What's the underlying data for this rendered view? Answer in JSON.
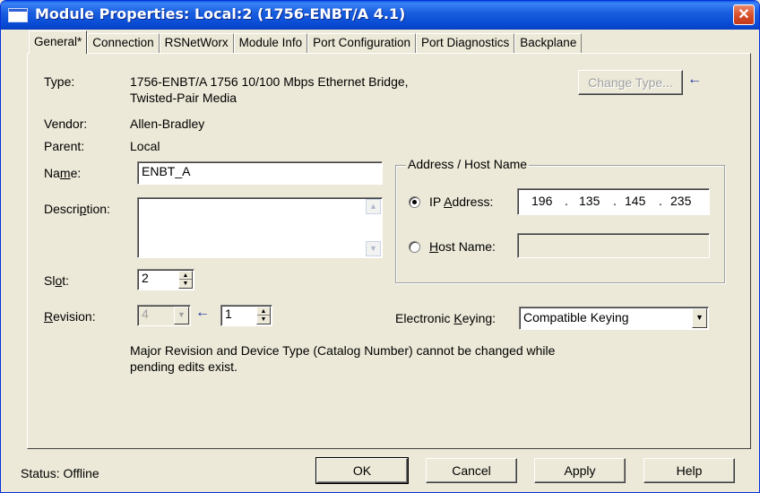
{
  "window": {
    "title": "Module Properties: Local:2 (1756-ENBT/A 4.1)"
  },
  "tabs": [
    {
      "label": "General*",
      "active": true
    },
    {
      "label": "Connection"
    },
    {
      "label": "RSNetWorx"
    },
    {
      "label": "Module Info"
    },
    {
      "label": "Port Configuration"
    },
    {
      "label": "Port Diagnostics"
    },
    {
      "label": "Backplane"
    }
  ],
  "general": {
    "type_label": "Type:",
    "type_value_line1": "1756-ENBT/A 1756 10/100 Mbps Ethernet Bridge,",
    "type_value_line2": "Twisted-Pair Media",
    "change_type_button": "Change Type...",
    "vendor_label": "Vendor:",
    "vendor_value": "Allen-Bradley",
    "parent_label": "Parent:",
    "parent_value": "Local",
    "name_label": "Name:",
    "name_value": "ENBT_A",
    "description_label": "Description:",
    "description_value": "",
    "slot_label": "Slot:",
    "slot_value": "2",
    "revision_label": "Revision:",
    "revision_major": "4",
    "revision_minor": "1",
    "note_line1": "Major Revision and Device Type (Catalog Number) cannot be changed while",
    "note_line2": "pending edits exist."
  },
  "address": {
    "group_title": "Address / Host Name",
    "ip_radio_label": "IP Address:",
    "ip_octets": [
      "196",
      "135",
      "145",
      "235"
    ],
    "host_radio_label": "Host Name:",
    "host_value": "",
    "selected": "ip"
  },
  "keying": {
    "label": "Electronic Keying:",
    "value": "Compatible Keying"
  },
  "footer": {
    "status": "Status:  Offline",
    "ok": "OK",
    "cancel": "Cancel",
    "apply": "Apply",
    "help": "Help"
  }
}
